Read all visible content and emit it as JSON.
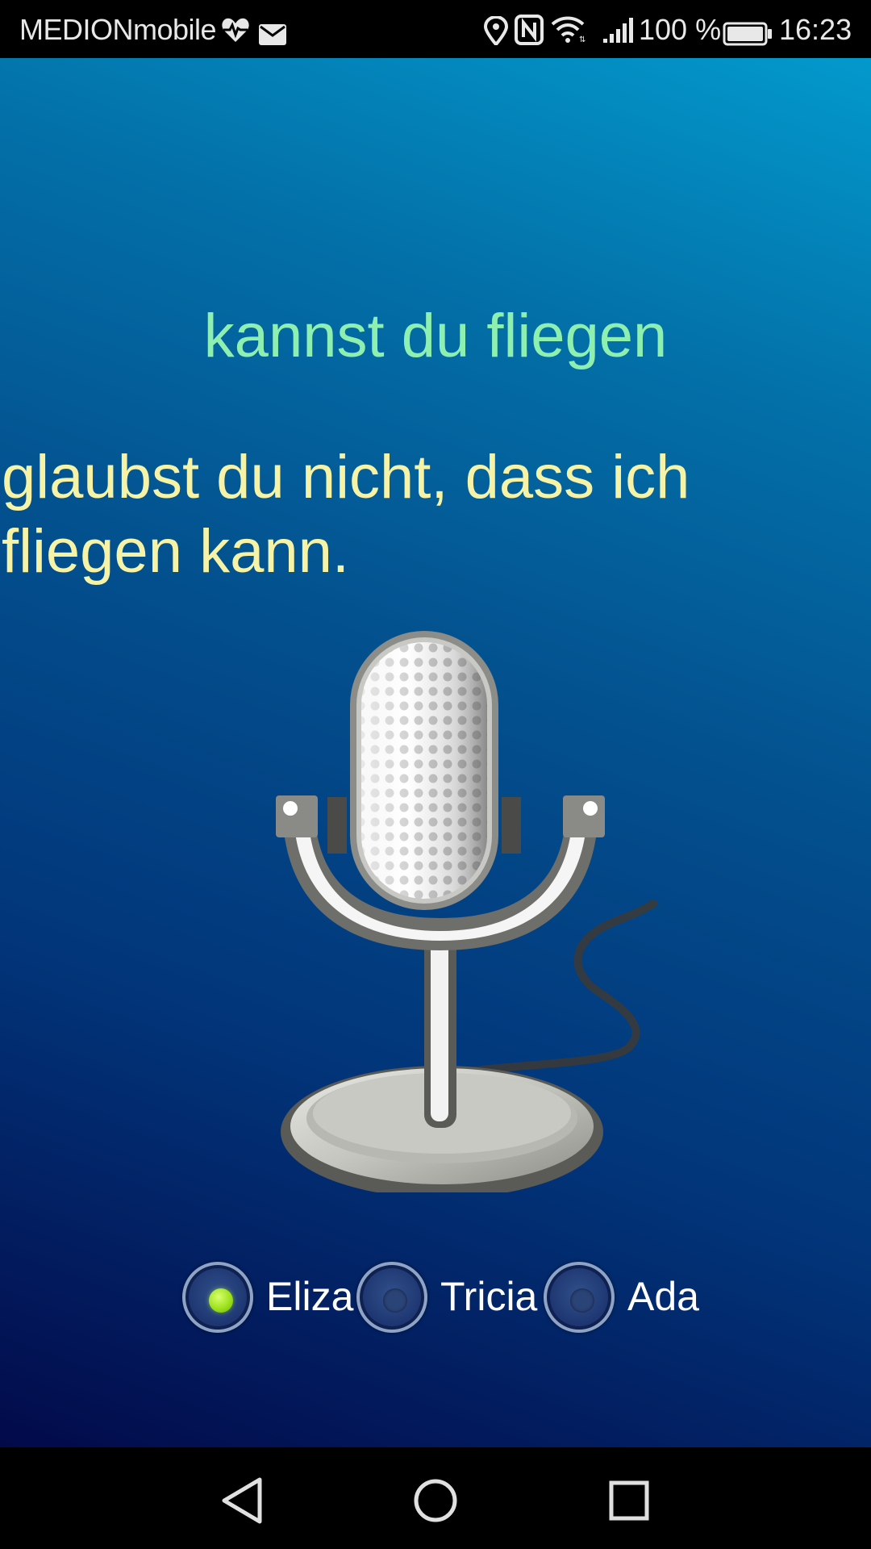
{
  "status_bar": {
    "carrier": "MEDIONmobile",
    "battery_level": "100 %",
    "time": "16:23",
    "icons": [
      "heart-rate-icon",
      "mail-icon",
      "location-icon",
      "nfc-icon",
      "wifi-icon",
      "signal-icon",
      "battery-icon"
    ]
  },
  "conversation": {
    "user_utterance": "kannst du fliegen",
    "assistant_reply": "glaubst du nicht, dass ich fliegen kann."
  },
  "microphone": {
    "icon": "microphone-icon"
  },
  "voices": {
    "options": [
      {
        "label": "Eliza",
        "selected": true
      },
      {
        "label": "Tricia",
        "selected": false
      },
      {
        "label": "Ada",
        "selected": false
      }
    ],
    "selected_color": "#9ee21d"
  },
  "nav_bar": {
    "icons": [
      "back-icon",
      "home-icon",
      "recents-icon"
    ]
  },
  "colors": {
    "user_text": "#8ef0b0",
    "reply_text": "#f6f3a6",
    "background_top": "#0399cc",
    "background_bottom": "#020a4a"
  }
}
